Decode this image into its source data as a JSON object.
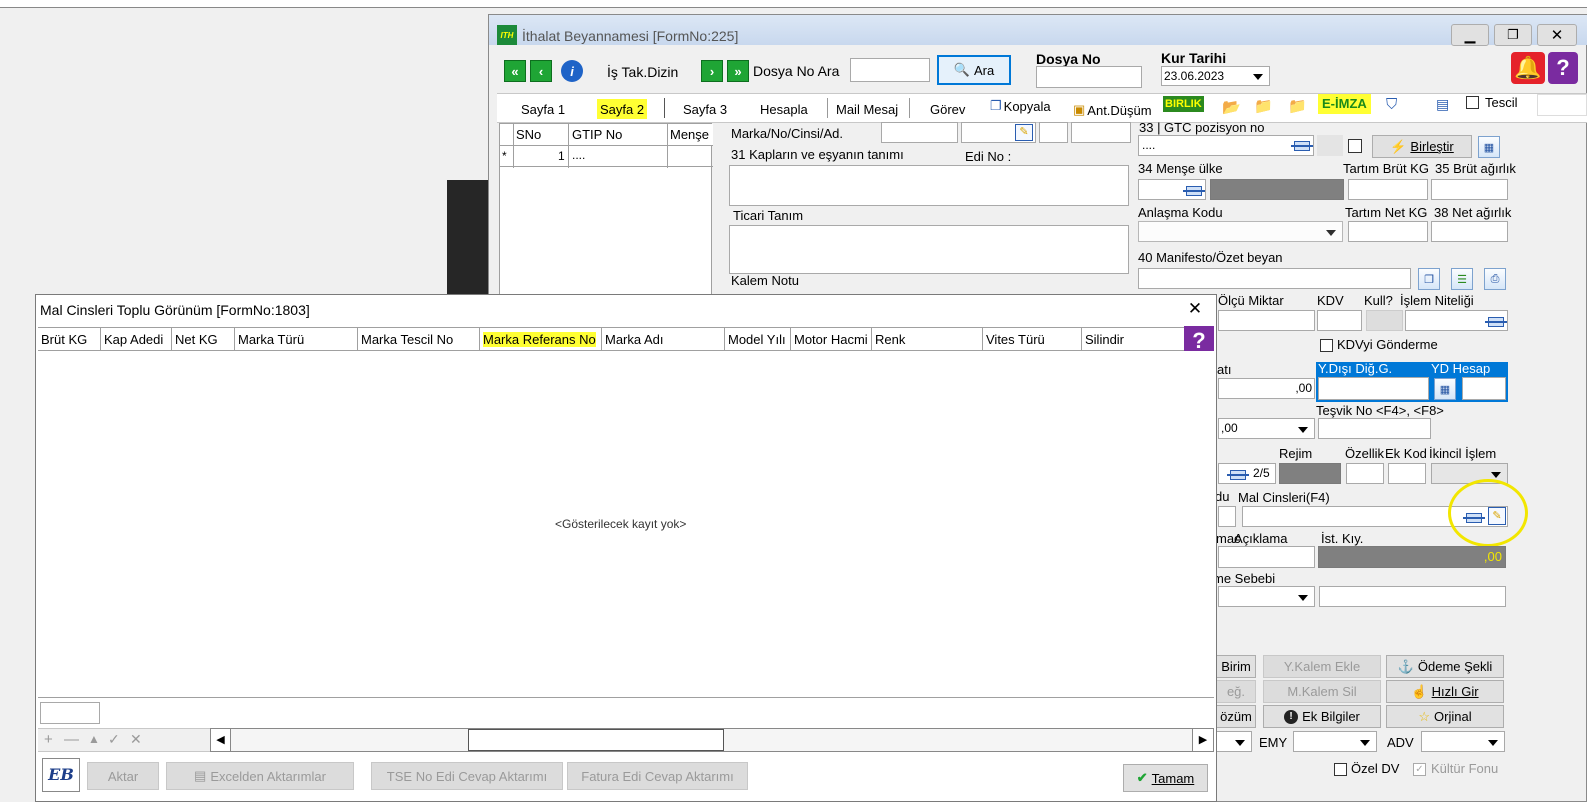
{
  "main_window": {
    "title": "İthalat Beyannamesi [FormNo:225]",
    "toolbar": {
      "is_tak_dizin": "İş Tak.Dizin",
      "dosya_no_ara": "Dosya No Ara",
      "ara_button": "Ara",
      "dosya_no_label": "Dosya No",
      "kur_tarihi_label": "Kur Tarihi",
      "kur_tarihi_value": "23.06.2023"
    },
    "tabs": [
      {
        "label": "Sayfa 1"
      },
      {
        "label": "Sayfa 2"
      },
      {
        "label": "Sayfa 3"
      },
      {
        "label": "Hesapla"
      },
      {
        "label": "Mail Mesaj"
      },
      {
        "label": "Görev"
      },
      {
        "label": "Kopyala"
      },
      {
        "label": "Ant.Düşüm"
      },
      {
        "label": "BIRLIK"
      },
      {
        "label": "E-İMZA"
      },
      {
        "label": "Tescil"
      }
    ],
    "grid": {
      "headers": [
        "SNo",
        "GTIP No",
        "Menşe"
      ],
      "row": {
        "marker": "*",
        "sno": "1",
        "gtip": "...."
      }
    },
    "fields": {
      "marka_no": "Marka/No/Cinsi/Ad.",
      "kaplar": "31 Kapların ve eşyanın tanımı",
      "edi_no": "Edi No :",
      "ticari_tanim": "Ticari Tanım",
      "kalem_notu": "Kalem Notu",
      "gtc": "33 | GTC pozisyon no",
      "gtc_value": "....",
      "birlestir": "Birleştir",
      "mense_ulke": "34 Menşe ülke",
      "tartim_brut": "Tartım Brüt KG",
      "brut_agirlik": "35 Brüt ağırlık",
      "anlasma_kodu": "Anlaşma Kodu",
      "tartim_net": "Tartım Net KG",
      "net_agirlik": "38 Net ağırlık",
      "manifesto": "40 Manifesto/Özet beyan",
      "olcu_miktar": "Ölçü Miktar",
      "kdv": "KDV",
      "kull": "Kull?",
      "islem_niteligi": "İşlem Niteliği",
      "kdvyi_gonderme": "KDVyi Gönderme",
      "atı": "atı",
      "val_00a": ",00",
      "ydisi": "Y.Dışı Diğ.G.",
      "yd_hesap": "YD Hesap",
      "val_00b": ",00",
      "tesvik_no": "Teşvik No <F4>, <F8>",
      "rejim": "Rejim",
      "rejim_value": "2/5",
      "ozellik": "Özellik",
      "ek_kod": "Ek Kod",
      "ikincil_islem": "İkincil İşlem",
      "du": "du",
      "mal_cinsleri": "Mal Cinsleri(F4)",
      "mac": "mac",
      "aciklama": "Açıklama",
      "ist_kiy": "İst. Kıy.",
      "ist_kiy_value": ",00",
      "me_sebebi": "me Sebebi",
      "emy": "EMY",
      "adv": "ADV",
      "ozel_dv": "Özel DV",
      "kultur_fonu": "Kültür Fonu"
    },
    "buttons": {
      "birim": "Birim",
      "y_kalem_ekle": "Y.Kalem Ekle",
      "odeme_sekli": "Ödeme Şekli",
      "deg": "eğ.",
      "m_kalem_sil": "M.Kalem Sil",
      "hizli_gir": "Hızlı Gir",
      "cozum": "özüm",
      "ek_bilgiler": "Ek Bilgiler",
      "orjinal": "Orjinal"
    }
  },
  "dialog": {
    "title": "Mal Cinsleri Toplu Görünüm [FormNo:1803]",
    "columns": [
      "Brüt KG",
      "Kap Adedi",
      "Net KG",
      "Marka Türü",
      "Marka Tescil No",
      "Marka Referans No",
      "Marka Adı",
      "Model Yılı",
      "Motor Hacmi",
      "Renk",
      "Vites Türü",
      "Silindir"
    ],
    "empty_text": "<Gösterilecek kayıt yok>",
    "footer_buttons": {
      "aktar": "Aktar",
      "excelden": "Excelden Aktarımlar",
      "tse": "TSE No Edi Cevap Aktarımı",
      "fatura": "Fatura Edi Cevap Aktarımı",
      "tamam": "Tamam"
    },
    "logo_text": "EB"
  },
  "colors": {
    "highlight": "#ffff33",
    "annotation_circle": "#f2e600",
    "green_nav": "#1fa535",
    "selected_blue": "#0078d7"
  }
}
